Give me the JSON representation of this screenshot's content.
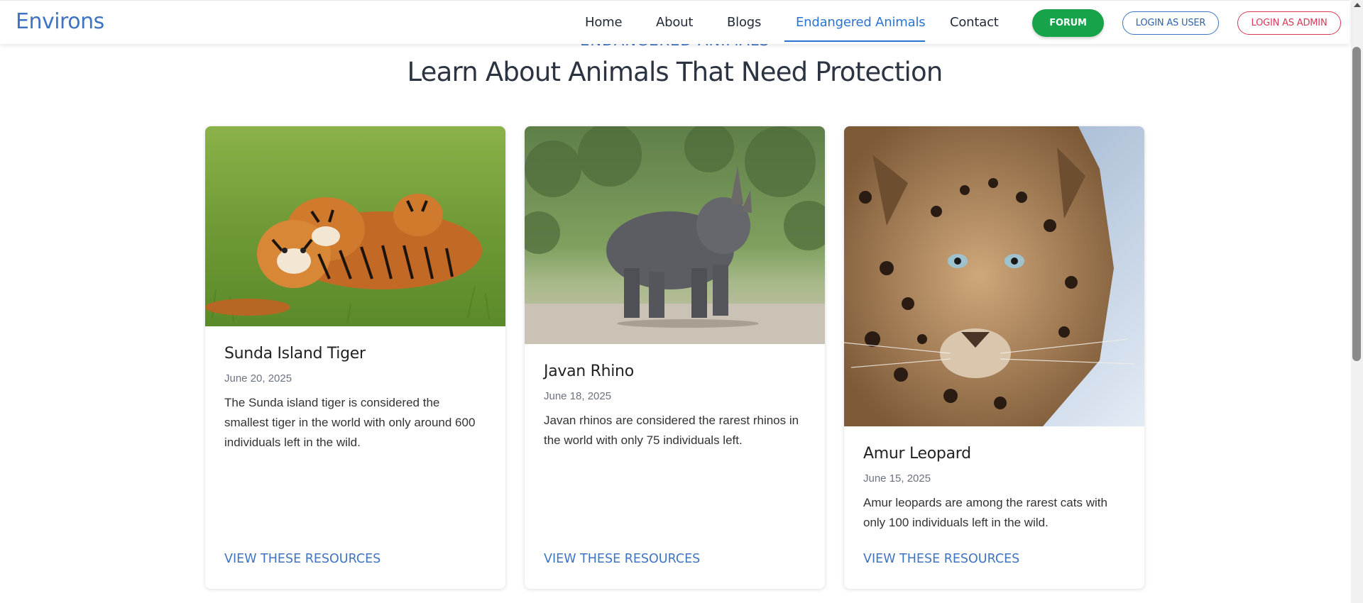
{
  "brand": "Environs",
  "nav": {
    "links": [
      "Home",
      "About",
      "Blogs",
      "Endangered Animals",
      "Contact"
    ],
    "active": "Endangered Animals",
    "forum_label": "FORUM",
    "login_user_label": "LOGIN AS USER",
    "login_admin_label": "LOGIN AS ADMIN"
  },
  "section": {
    "eyebrow": "ENDANGERED ANIMALS",
    "title": "Learn About Animals That Need Protection"
  },
  "cards": [
    {
      "title": "Sunda Island Tiger",
      "date": "June 20, 2025",
      "text": "The Sunda island tiger is considered the smallest tiger in the world with only around 600 individuals left in the wild.",
      "link": "VIEW THESE RESOURCES",
      "image_icon": "tiger-photo"
    },
    {
      "title": "Javan Rhino",
      "date": "June 18, 2025",
      "text": "Javan rhinos are considered the rarest rhinos in the world with only 75 individuals left.",
      "link": "VIEW THESE RESOURCES",
      "image_icon": "rhino-photo"
    },
    {
      "title": "Amur Leopard",
      "date": "June 15, 2025",
      "text": "Amur leopards are among the rarest cats with only 100 individuals left in the wild.",
      "link": "VIEW THESE RESOURCES",
      "image_icon": "leopard-photo"
    }
  ],
  "colors": {
    "brand": "#3f74c3",
    "active_nav": "#2a74d4",
    "forum_bg": "#17a34a",
    "admin": "#d63a55",
    "heading": "#2b3440"
  }
}
